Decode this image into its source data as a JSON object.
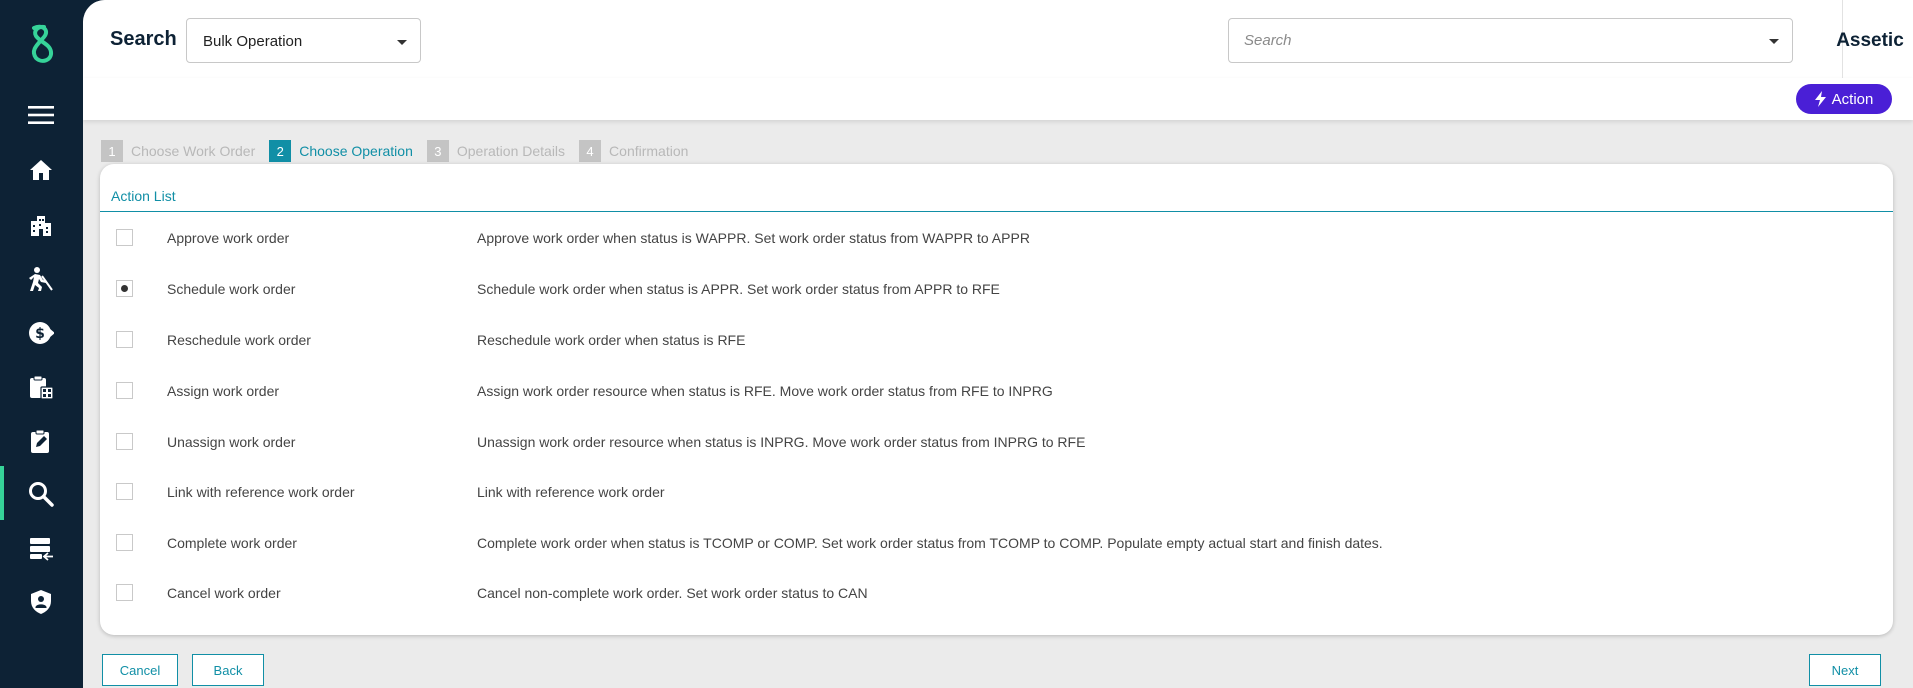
{
  "header": {
    "title": "Search",
    "operation_select": "Bulk Operation",
    "search_placeholder": "Search",
    "org_name": "Assetic"
  },
  "actionbar": {
    "action_label": "Action"
  },
  "stepper": {
    "steps": [
      {
        "num": "1",
        "label": "Choose Work Order"
      },
      {
        "num": "2",
        "label": "Choose Operation"
      },
      {
        "num": "3",
        "label": "Operation Details"
      },
      {
        "num": "4",
        "label": "Confirmation"
      }
    ],
    "active_step": 2
  },
  "action_list": {
    "title": "Action List",
    "rows": [
      {
        "name": "Approve work order",
        "description": "Approve work order when status is WAPPR. Set work order status from WAPPR to APPR",
        "selected": false
      },
      {
        "name": "Schedule work order",
        "description": "Schedule work order when status is APPR. Set work order status from APPR to RFE",
        "selected": true
      },
      {
        "name": "Reschedule work order",
        "description": "Reschedule work order when status is RFE",
        "selected": false
      },
      {
        "name": "Assign work order",
        "description": "Assign work order resource when status is RFE. Move work order status from RFE to INPRG",
        "selected": false
      },
      {
        "name": "Unassign work order",
        "description": "Unassign work order resource when status is INPRG. Move work order status from INPRG to RFE",
        "selected": false
      },
      {
        "name": "Link with reference work order",
        "description": "Link with reference work order",
        "selected": false
      },
      {
        "name": "Complete work order",
        "description": "Complete work order when status is TCOMP or COMP. Set work order status from TCOMP to COMP. Populate empty actual start and finish dates.",
        "selected": false
      },
      {
        "name": "Cancel work order",
        "description": "Cancel non-complete work order. Set work order status to CAN",
        "selected": false
      }
    ]
  },
  "footer": {
    "cancel_label": "Cancel",
    "back_label": "Back",
    "next_label": "Next"
  },
  "sidebar": {
    "items": [
      "menu-icon",
      "home-icon",
      "buildings-icon",
      "worker-icon",
      "finance-icon",
      "clipboard-icon",
      "edit-document-icon",
      "search-icon",
      "server-list-icon",
      "shield-user-icon"
    ],
    "active": "search-icon"
  },
  "colors": {
    "sidebar_bg": "#0d2235",
    "accent_teal": "#118fa6",
    "action_purple": "#4a1fd6",
    "brand_green": "#36d399"
  }
}
